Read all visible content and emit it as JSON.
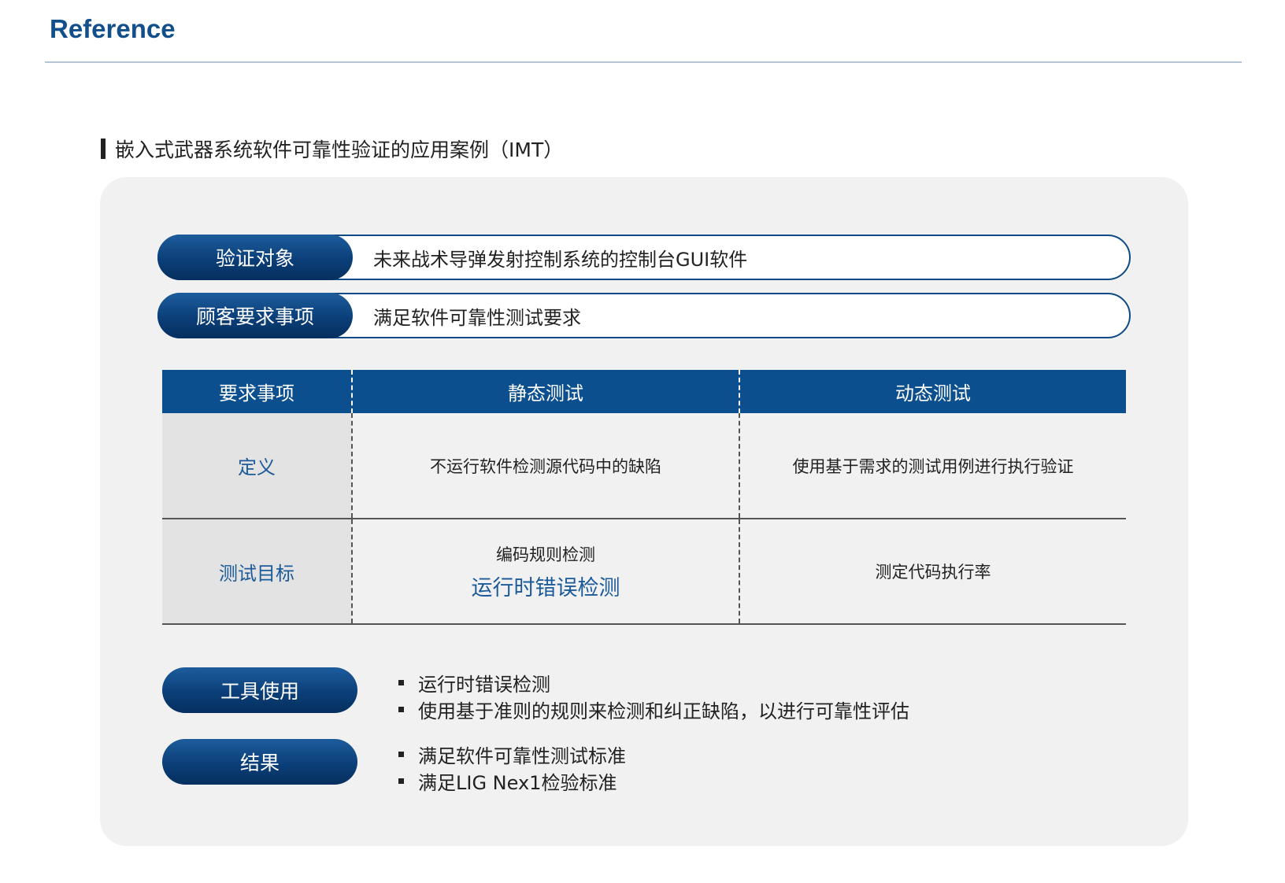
{
  "header": {
    "title": "Reference"
  },
  "section": {
    "title": "嵌入式武器系统软件可靠性验证的应用案例（IMT）"
  },
  "overview": [
    {
      "label": "验证对象",
      "value": "未来战术导弹发射控制系统的控制台GUI软件"
    },
    {
      "label": "顾客要求事项",
      "value": "满足软件可靠性测试要求"
    }
  ],
  "table": {
    "headers": [
      "要求事项",
      "静态测试",
      "动态测试"
    ],
    "rows": [
      {
        "label": "定义",
        "static": "不运行软件检测源代码中的缺陷",
        "dynamic": "使用基于需求的测试用例进行执行验证"
      },
      {
        "label": "测试目标",
        "static": "编码规则检测",
        "static_highlight": "运行时错误检测",
        "dynamic": "测定代码执行率"
      }
    ]
  },
  "tools": {
    "label": "工具使用",
    "items": [
      "运行时错误检测",
      "使用基于准则的规则来检测和纠正缺陷，以进行可靠性评估"
    ]
  },
  "result": {
    "label": "结果",
    "items": [
      "满足软件可靠性测试标准",
      "满足LIG Nex1检验标准"
    ]
  }
}
